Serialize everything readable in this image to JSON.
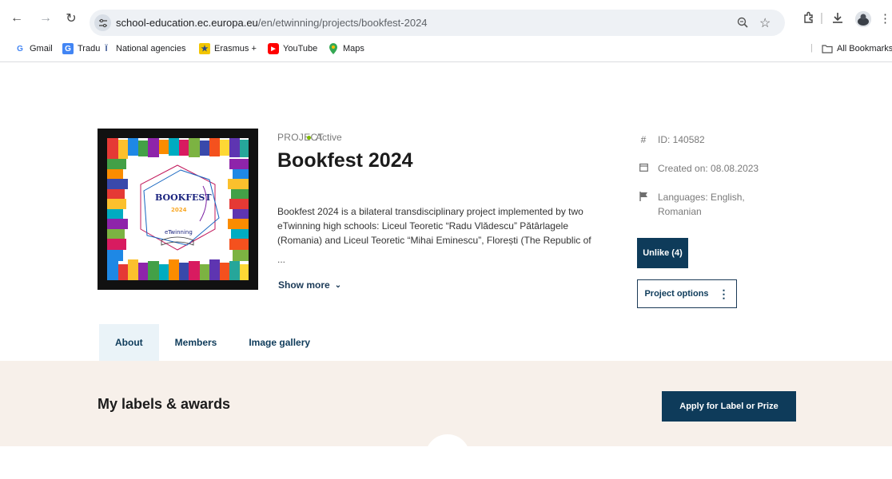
{
  "browser": {
    "url_host": "school-education.ec.europa.eu",
    "url_path": "/en/etwinning/projects/bookfest-2024",
    "bookmarks": [
      {
        "label": "Gmail",
        "icon": "gmail-icon",
        "color": "#ea4335"
      },
      {
        "label": "Tradu",
        "icon": "translate-icon",
        "color": "#4285f4"
      },
      {
        "label": "National agencies",
        "icon": "national-agencies-icon",
        "color": "#2b4a8b"
      },
      {
        "label": "Erasmus +",
        "icon": "erasmus-icon",
        "color": "#f2c500"
      },
      {
        "label": "YouTube",
        "icon": "youtube-icon",
        "color": "#ff0000"
      },
      {
        "label": "Maps",
        "icon": "maps-icon",
        "color": "#34a853"
      }
    ],
    "all_bookmarks": "All Bookmarks"
  },
  "project": {
    "type_label": "PROJECT",
    "status": "Active",
    "status_color": "#7fb800",
    "title": "Bookfest 2024",
    "description": "Bookfest 2024 is a bilateral transdisciplinary project implemented by two eTwinning high schools: Liceul Teoretic “Radu Vlădescu” Pătârlagele (Romania) and Liceul Teoretic “Mihai Eminescu”, Florești (The Republic of",
    "ellipsis": "...",
    "show_more": "Show more",
    "cover_text_top": "BOOKFEST",
    "cover_text_year": "2024",
    "cover_text_brand": "eTwinning"
  },
  "meta": {
    "id": "ID: 140582",
    "created": "Created on: 08.08.2023",
    "languages_line1": "Languages: English,",
    "languages_line2": "Romanian"
  },
  "actions": {
    "unlike": "Unlike (4)",
    "project_options": "Project options"
  },
  "tabs": [
    {
      "label": "About",
      "active": true
    },
    {
      "label": "Members",
      "active": false
    },
    {
      "label": "Image gallery",
      "active": false
    }
  ],
  "awards": {
    "title": "My labels & awards",
    "apply_button": "Apply for Label or Prize"
  },
  "colors": {
    "accent": "#0e3b5a",
    "awards_bg": "#f7f0ea",
    "active_tab_bg": "#eaf3f8"
  }
}
